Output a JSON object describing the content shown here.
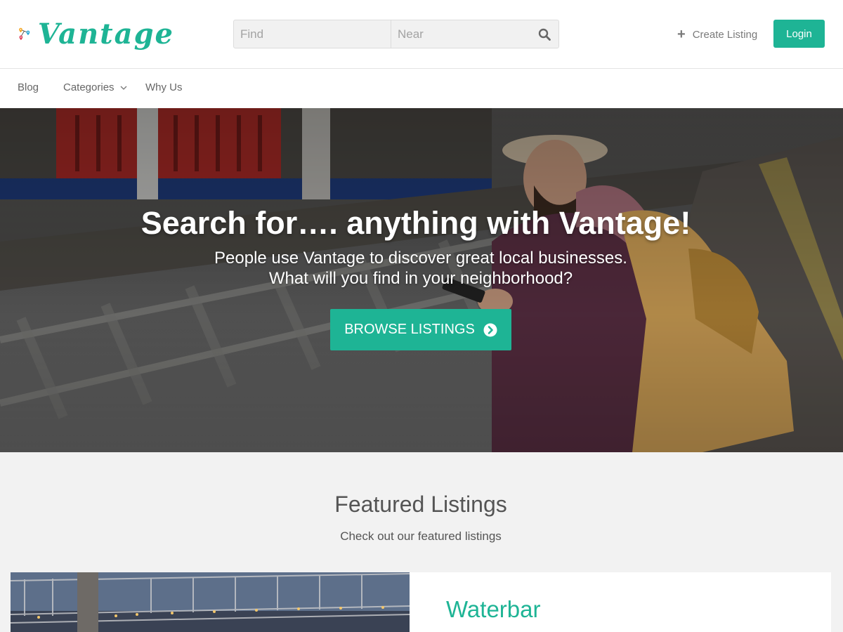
{
  "brand": {
    "name": "Vantage",
    "accent": "#1eb495"
  },
  "header": {
    "search": {
      "find_placeholder": "Find",
      "near_placeholder": "Near",
      "icon": "search-icon"
    },
    "create_listing_label": "Create Listing",
    "login_label": "Login"
  },
  "nav": {
    "items": [
      {
        "label": "Blog"
      },
      {
        "label": "Categories",
        "has_dropdown": true
      },
      {
        "label": "Why Us"
      }
    ]
  },
  "hero": {
    "title": "Search for…. anything with Vantage!",
    "subtitle_line1": "People use Vantage to discover great local businesses.",
    "subtitle_line2": "What will you find in your neighborhood?",
    "button_label": "BROWSE LISTINGS",
    "button_icon": "arrow-circle-right-icon"
  },
  "featured": {
    "title": "Featured Listings",
    "subtitle": "Check out our featured listings",
    "listings": [
      {
        "name": "Waterbar"
      }
    ]
  }
}
